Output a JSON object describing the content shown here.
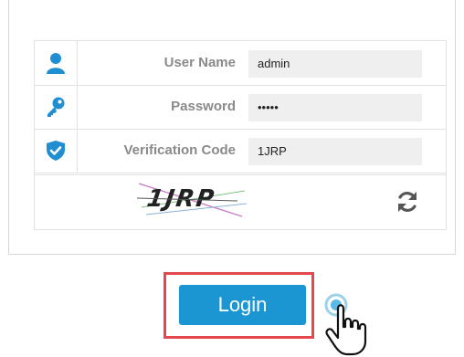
{
  "form": {
    "username": {
      "label": "User Name",
      "value": "admin"
    },
    "password": {
      "label": "Password",
      "value": "•••••"
    },
    "verification": {
      "label": "Verification Code",
      "value": "1JRP"
    }
  },
  "captcha": {
    "text": "1JRP"
  },
  "actions": {
    "login_label": "Login"
  },
  "icons": {
    "user": "user-icon",
    "password": "key-icon",
    "verification": "shield-check-icon",
    "refresh": "refresh-icon",
    "cursor": "hand-pointer-icon"
  },
  "colors": {
    "accent": "#1b96d2",
    "highlight_border": "#e4474d",
    "icon_blue": "#1f8fd1"
  }
}
